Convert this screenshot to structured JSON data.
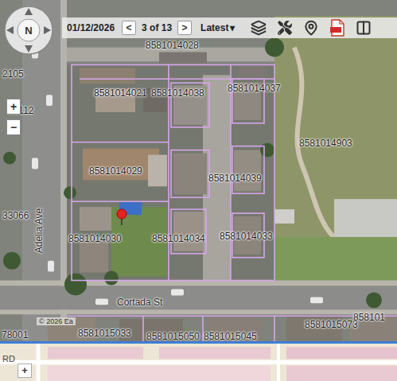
{
  "toolbar": {
    "date": "01/12/2026",
    "prev_button": "<",
    "page": "3 of 13",
    "next_button": ">",
    "layer_select": "Latest",
    "layer_caret": "▾"
  },
  "navigation": {
    "compass_label": "N",
    "zoom_in": "+",
    "zoom_out": "−"
  },
  "parcels": [
    {
      "label": "8581014028"
    },
    {
      "label": "8581014021"
    },
    {
      "label": "8581014038"
    },
    {
      "label": "8581014037"
    },
    {
      "label": "8581014903"
    },
    {
      "label": "8581014029"
    },
    {
      "label": "8581014039"
    },
    {
      "label": "8581014030"
    },
    {
      "label": "8581014034"
    },
    {
      "label": "8581014033"
    },
    {
      "label": "8581015033"
    },
    {
      "label": "8581015050"
    },
    {
      "label": "8581015045"
    },
    {
      "label": "8581015073"
    },
    {
      "label": "858101"
    },
    {
      "label": "78001"
    },
    {
      "label": "12112"
    },
    {
      "label": "2105"
    },
    {
      "label": "33066"
    }
  ],
  "streets": [
    {
      "label": "Adelia Ave",
      "kind": "vertical"
    },
    {
      "label": "Cortada St",
      "kind": "horizontal"
    }
  ],
  "attribution": "© 2026 Ea",
  "overview": {
    "zoom_in": "+",
    "road_label": "RD"
  }
}
